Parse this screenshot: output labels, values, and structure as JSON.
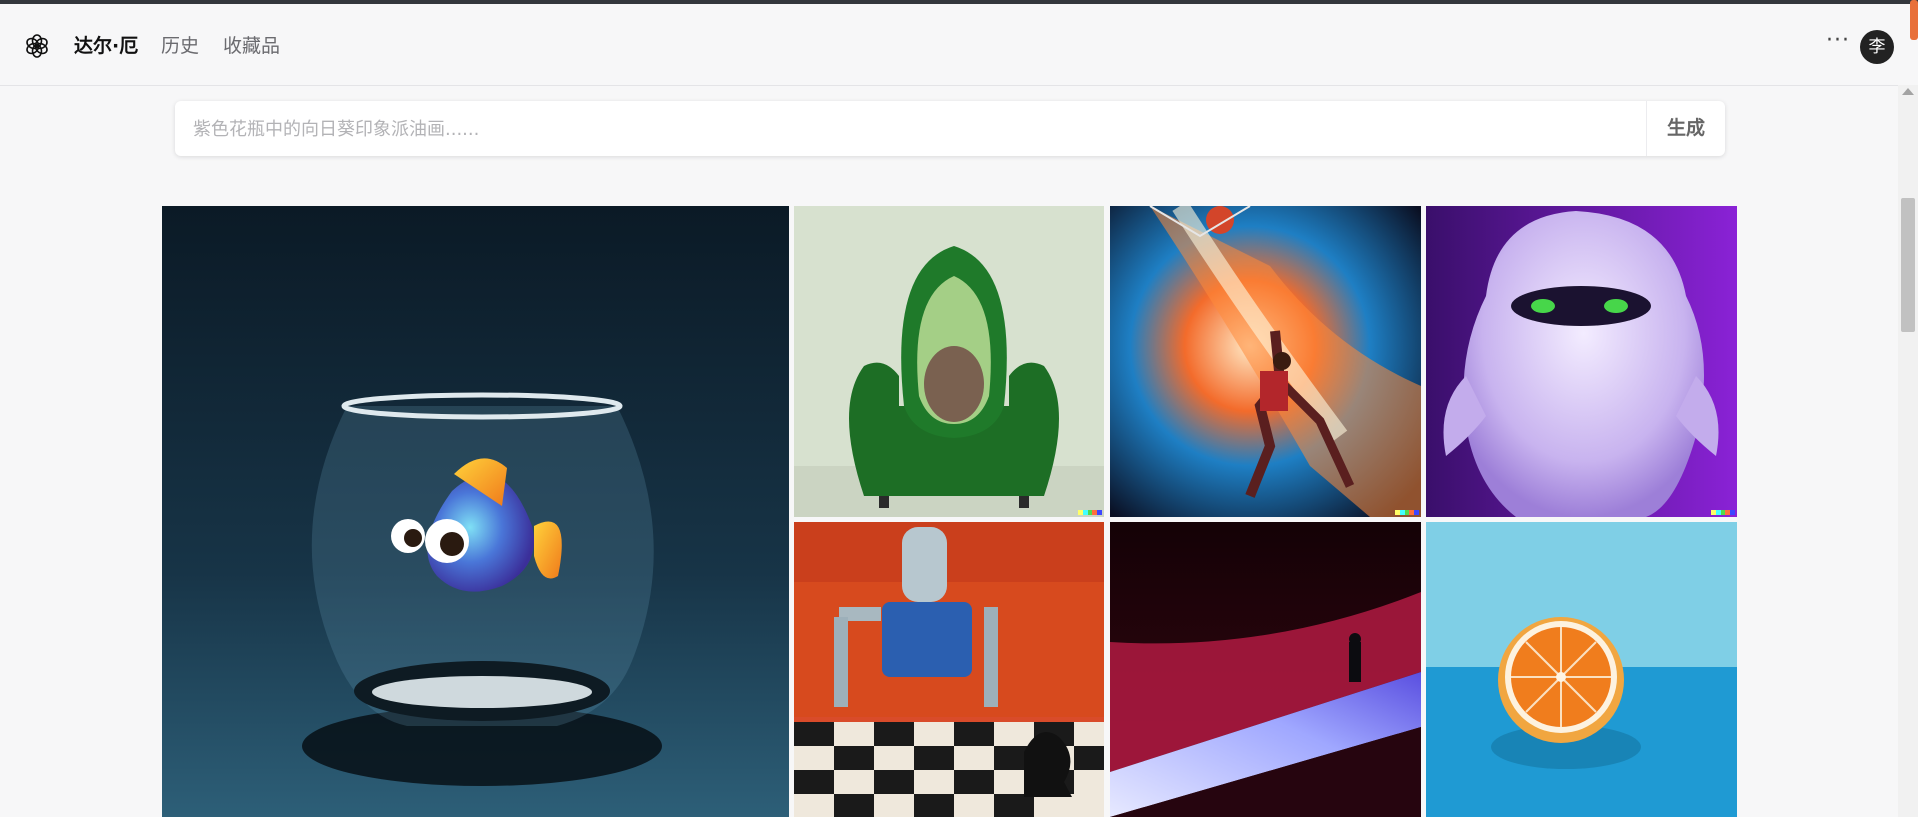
{
  "app": {
    "avatar_initial": "李"
  },
  "nav": {
    "brand": "达尔·厄",
    "history": "历史",
    "collections": "收藏品"
  },
  "header": {
    "more_label": "···"
  },
  "prompt": {
    "placeholder": "紫色花瓶中的向日葵印象派油画......",
    "value": "",
    "generate_label": "生成"
  },
  "gallery": {
    "images": [
      "fish-in-bowl",
      "avocado-armchair",
      "cosmic-basketball-player",
      "purple-furry-monster",
      "robot-playing-chess",
      "figure-in-light-desert",
      "halved-orange-on-blue"
    ]
  },
  "colors": {
    "accent": "#e8703a",
    "text": "#111111",
    "muted": "#6b6b6f"
  }
}
